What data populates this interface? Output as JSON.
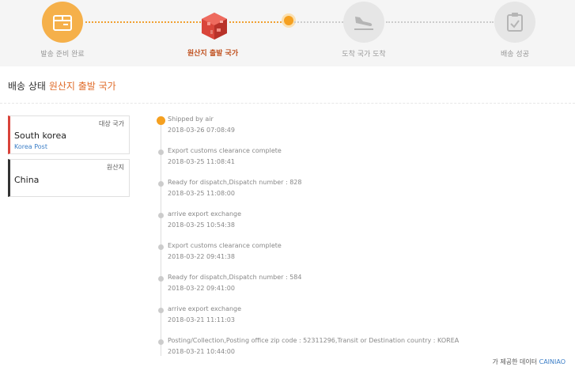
{
  "progress": {
    "steps": [
      {
        "label": "발송 준비 완료",
        "icon": "package-icon",
        "state": "done"
      },
      {
        "label": "원산지 출발 국가",
        "icon": "cube-icon",
        "state": "current"
      },
      {
        "label": "도착 국가 도착",
        "icon": "plane-landing-icon",
        "state": "pending"
      },
      {
        "label": "배송 성공",
        "icon": "clipboard-check-icon",
        "state": "pending"
      }
    ],
    "colors": {
      "active": "#f5a020",
      "inactive": "#e6e6e6",
      "current_label": "#c0501e"
    }
  },
  "status": {
    "prefix": "배송 상태",
    "highlight": "원산지 출발 국가",
    "highlight_color": "#e06c2a"
  },
  "destination": {
    "tag": "대상 국가",
    "country": "South korea",
    "carrier": "Korea Post"
  },
  "origin": {
    "tag": "원산지",
    "country": "China"
  },
  "events": [
    {
      "desc": "Shipped by air",
      "time": "2018-03-26 07:08:49"
    },
    {
      "desc": "Export customs clearance complete",
      "time": "2018-03-25 11:08:41"
    },
    {
      "desc": "Ready for dispatch,Dispatch number : 828",
      "time": "2018-03-25 11:08:00"
    },
    {
      "desc": "arrive export exchange",
      "time": "2018-03-25 10:54:38"
    },
    {
      "desc": "Export customs clearance complete",
      "time": "2018-03-22 09:41:38"
    },
    {
      "desc": "Ready for dispatch,Dispatch number : 584",
      "time": "2018-03-22 09:41:00"
    },
    {
      "desc": "arrive export exchange",
      "time": "2018-03-21 11:11:03"
    },
    {
      "desc": "Posting/Collection,Posting office zip code : 52311296,Transit or Destination country : KOREA",
      "time": "2018-03-21 10:44:00"
    }
  ],
  "footer": {
    "prefix": "가 제공한 데이터",
    "brand": "CAINIAO"
  }
}
